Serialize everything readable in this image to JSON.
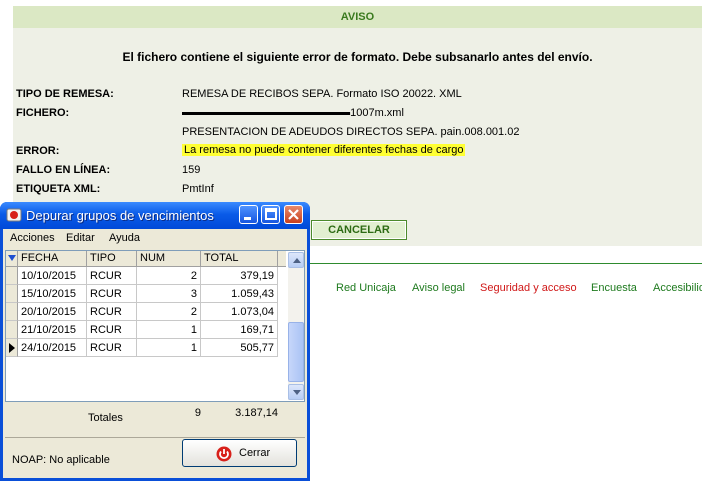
{
  "aviso": {
    "header": "AVISO",
    "message": "El fichero contiene el siguiente error de formato. Debe subsanarlo antes del envío.",
    "rows": [
      {
        "label": "TIPO DE REMESA:",
        "value": "REMESA DE RECIBOS SEPA. Formato ISO 20022. XML"
      },
      {
        "label": "FICHERO:",
        "value": "1007m.xml",
        "value2": "PRESENTACION DE ADEUDOS DIRECTOS SEPA. pain.008.001.02"
      },
      {
        "label": "ERROR:",
        "value": "La remesa no puede contener diferentes fechas de cargo"
      },
      {
        "label": "FALLO EN LÍNEA:",
        "value": "159"
      },
      {
        "label": "ETIQUETA XML:",
        "value": "PmtInf"
      }
    ],
    "cancel_label": "CANCELAR",
    "highlight_color": "#ffff33"
  },
  "footer_links": [
    "Red Unicaja",
    "Aviso legal",
    "Seguridad y acceso",
    "Encuesta",
    "Accesibilid"
  ],
  "dialog": {
    "title": "Depurar grupos de vencimientos",
    "menu": [
      "Acciones",
      "Editar",
      "Ayuda"
    ],
    "grid": {
      "columns": [
        "FECHA",
        "TIPO",
        "NUM",
        "TOTAL"
      ],
      "rows": [
        {
          "fecha": "10/10/2015",
          "tipo": "RCUR",
          "num": "2",
          "total": "379,19"
        },
        {
          "fecha": "15/10/2015",
          "tipo": "RCUR",
          "num": "3",
          "total": "1.059,43"
        },
        {
          "fecha": "20/10/2015",
          "tipo": "RCUR",
          "num": "2",
          "total": "1.073,04"
        },
        {
          "fecha": "21/10/2015",
          "tipo": "RCUR",
          "num": "1",
          "total": "169,71"
        },
        {
          "fecha": "24/10/2015",
          "tipo": "RCUR",
          "num": "1",
          "total": "505,77"
        }
      ],
      "current_row": 4
    },
    "totals_label": "Totales",
    "totals_num": "9",
    "totals_total": "3.187,14",
    "noap": "NOAP: No aplicable",
    "close_label": "Cerrar"
  }
}
